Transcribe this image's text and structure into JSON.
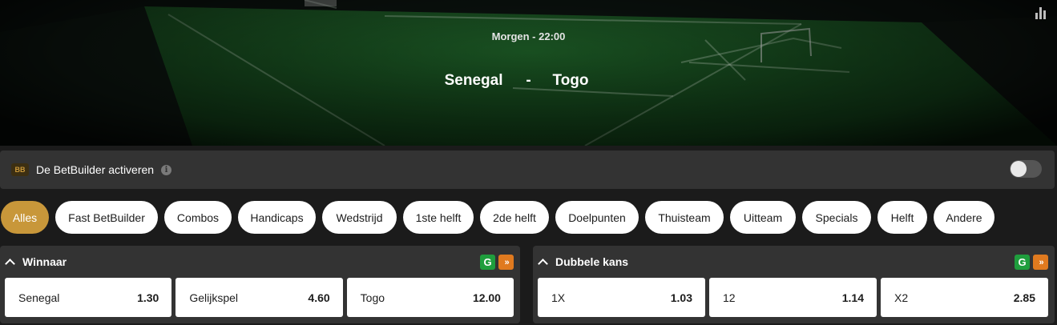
{
  "event": {
    "time": "Morgen - 22:00",
    "home": "Senegal",
    "separator": "-",
    "away": "Togo"
  },
  "betbuilder": {
    "badge": "BB",
    "label": "De BetBuilder activeren",
    "info": "i",
    "enabled": false
  },
  "filters": [
    {
      "label": "Alles",
      "active": true
    },
    {
      "label": "Fast BetBuilder",
      "active": false
    },
    {
      "label": "Combos",
      "active": false
    },
    {
      "label": "Handicaps",
      "active": false
    },
    {
      "label": "Wedstrijd",
      "active": false
    },
    {
      "label": "1ste helft",
      "active": false
    },
    {
      "label": "2de helft",
      "active": false
    },
    {
      "label": "Doelpunten",
      "active": false
    },
    {
      "label": "Thuisteam",
      "active": false
    },
    {
      "label": "Uitteam",
      "active": false
    },
    {
      "label": "Specials",
      "active": false
    },
    {
      "label": "Helft",
      "active": false
    },
    {
      "label": "Andere",
      "active": false
    }
  ],
  "markets": [
    {
      "title": "Winnaar",
      "odds": [
        {
          "label": "Senegal",
          "price": "1.30"
        },
        {
          "label": "Gelijkspel",
          "price": "4.60"
        },
        {
          "label": "Togo",
          "price": "12.00"
        }
      ]
    },
    {
      "title": "Dubbele kans",
      "odds": [
        {
          "label": "1X",
          "price": "1.03"
        },
        {
          "label": "12",
          "price": "1.14"
        },
        {
          "label": "X2",
          "price": "2.85"
        }
      ]
    }
  ],
  "market_icons": {
    "green": "G",
    "orange": "»"
  },
  "colors": {
    "accent": "#c8973a",
    "panel": "#333333",
    "background": "#1b1b1b",
    "green_icon": "#1f9e3d",
    "orange_icon": "#e07a1f"
  },
  "icons": [
    "stats-icon",
    "info-icon",
    "chevron-up-icon",
    "betbuilder-green-icon",
    "fast-forward-icon"
  ]
}
